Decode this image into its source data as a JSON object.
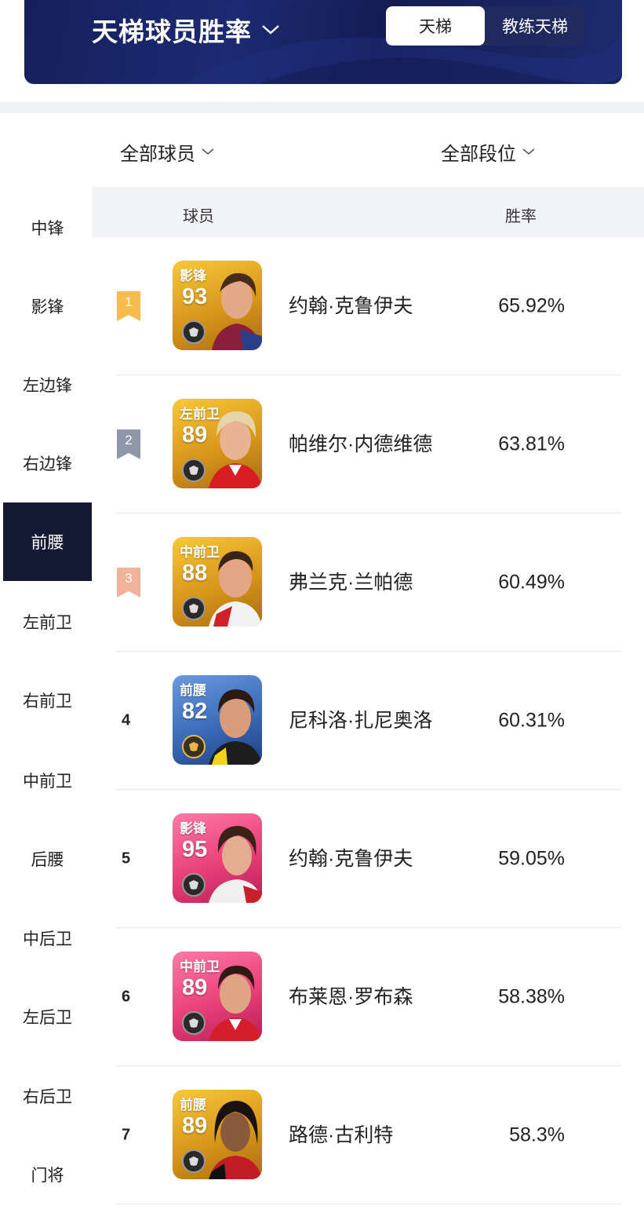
{
  "header": {
    "title": "天梯球员胜率",
    "tabs": [
      {
        "label": "天梯",
        "active": true
      },
      {
        "label": "教练天梯",
        "active": false
      }
    ]
  },
  "filters": {
    "players": "全部球员",
    "rank": "全部段位"
  },
  "sidebar": {
    "items": [
      {
        "label": "中锋",
        "active": false
      },
      {
        "label": "影锋",
        "active": false
      },
      {
        "label": "左边锋",
        "active": false
      },
      {
        "label": "右边锋",
        "active": false
      },
      {
        "label": "前腰",
        "active": true
      },
      {
        "label": "左前卫",
        "active": false
      },
      {
        "label": "右前卫",
        "active": false
      },
      {
        "label": "中前卫",
        "active": false
      },
      {
        "label": "后腰",
        "active": false
      },
      {
        "label": "中后卫",
        "active": false
      },
      {
        "label": "左后卫",
        "active": false
      },
      {
        "label": "右后卫",
        "active": false
      },
      {
        "label": "门将",
        "active": false
      }
    ]
  },
  "table": {
    "col_player": "球员",
    "col_winrate": "胜率",
    "rows": [
      {
        "rank": "1",
        "position": "影锋",
        "rating": "93",
        "name": "约翰·克鲁伊夫",
        "winrate": "65.92%",
        "card_color": "gold",
        "badge_color": "#f6bd4a"
      },
      {
        "rank": "2",
        "position": "左前卫",
        "rating": "89",
        "name": "帕维尔·内德维德",
        "winrate": "63.81%",
        "card_color": "gold",
        "badge_color": "#8f97ab"
      },
      {
        "rank": "3",
        "position": "中前卫",
        "rating": "88",
        "name": "弗兰克·兰帕德",
        "winrate": "60.49%",
        "card_color": "gold",
        "badge_color": "#f0b39a"
      },
      {
        "rank": "4",
        "position": "前腰",
        "rating": "82",
        "name": "尼科洛·扎尼奥洛",
        "winrate": "60.31%",
        "card_color": "blue",
        "badge_color": ""
      },
      {
        "rank": "5",
        "position": "影锋",
        "rating": "95",
        "name": "约翰·克鲁伊夫",
        "winrate": "59.05%",
        "card_color": "pink",
        "badge_color": ""
      },
      {
        "rank": "6",
        "position": "中前卫",
        "rating": "89",
        "name": "布莱恩·罗布森",
        "winrate": "58.38%",
        "card_color": "pink",
        "badge_color": ""
      },
      {
        "rank": "7",
        "position": "前腰",
        "rating": "89",
        "name": "路德·古利特",
        "winrate": "58.3%",
        "card_color": "gold",
        "badge_color": ""
      }
    ]
  },
  "icons": {
    "header_chevron": "chevron-down-icon",
    "filter_chevron": "chevron-down-icon",
    "rank_badge": "ribbon-badge-icon",
    "card_emblem": "emblem-icon"
  },
  "colors": {
    "header_bg": "#1a2566",
    "sidebar_active": "#141a33",
    "card_gold": "#e0a21c",
    "card_blue": "#3b6ab8",
    "card_pink": "#e8407a"
  }
}
